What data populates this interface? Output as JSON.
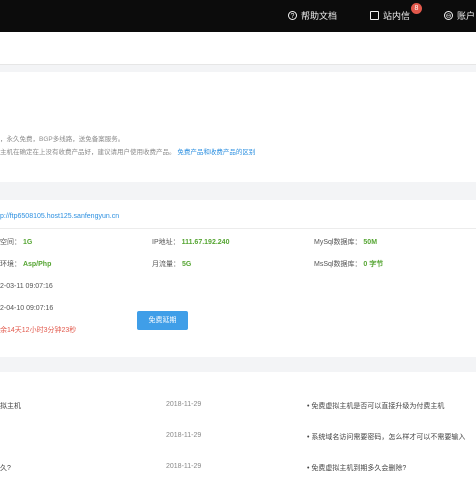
{
  "topbar": {
    "help_docs": "帮助文档",
    "messages": "站内信",
    "messages_badge": "8",
    "account_label": "账户"
  },
  "notice": {
    "line1": "，永久免费，BGP多线路，送免备案服务。",
    "line2_prefix": "主机在确定在上没有收费产品好，建议请用户使用收费产品。",
    "line2_link": "免费产品和收费产品的区别"
  },
  "host": {
    "url": "p://ftp6508105.host125.sanfengyun.cn",
    "space_label": "空间：",
    "space_value": "1G",
    "ip_label": "IP地址：",
    "ip_value": "111.67.192.240",
    "mysql_label": "MySql数据库：",
    "mysql_value": "50M",
    "env_label": "环境：",
    "env_value": "Asp/Php",
    "traffic_label": "月流量：",
    "traffic_value": "5G",
    "mssql_label": "MsSql数据库：",
    "mssql_value": "0 字节",
    "open_time": "2-03-11 09:07:16",
    "expire_time": "2-04-10 09:07:16",
    "remaining": "余14天12小时3分钟23秒",
    "extend_button": "免费延期"
  },
  "articles": [
    {
      "left": "拟主机",
      "date": "2018-11-29",
      "right": "• 免费虚拟主机是否可以直接升级为付费主机"
    },
    {
      "left": "",
      "date": "2018-11-29",
      "right": "• 系统域名访问需要密码，怎么样才可以不需要输入"
    },
    {
      "left": "久?",
      "date": "2018-11-29",
      "right": "• 免费虚拟主机到期多久会删除?"
    }
  ]
}
